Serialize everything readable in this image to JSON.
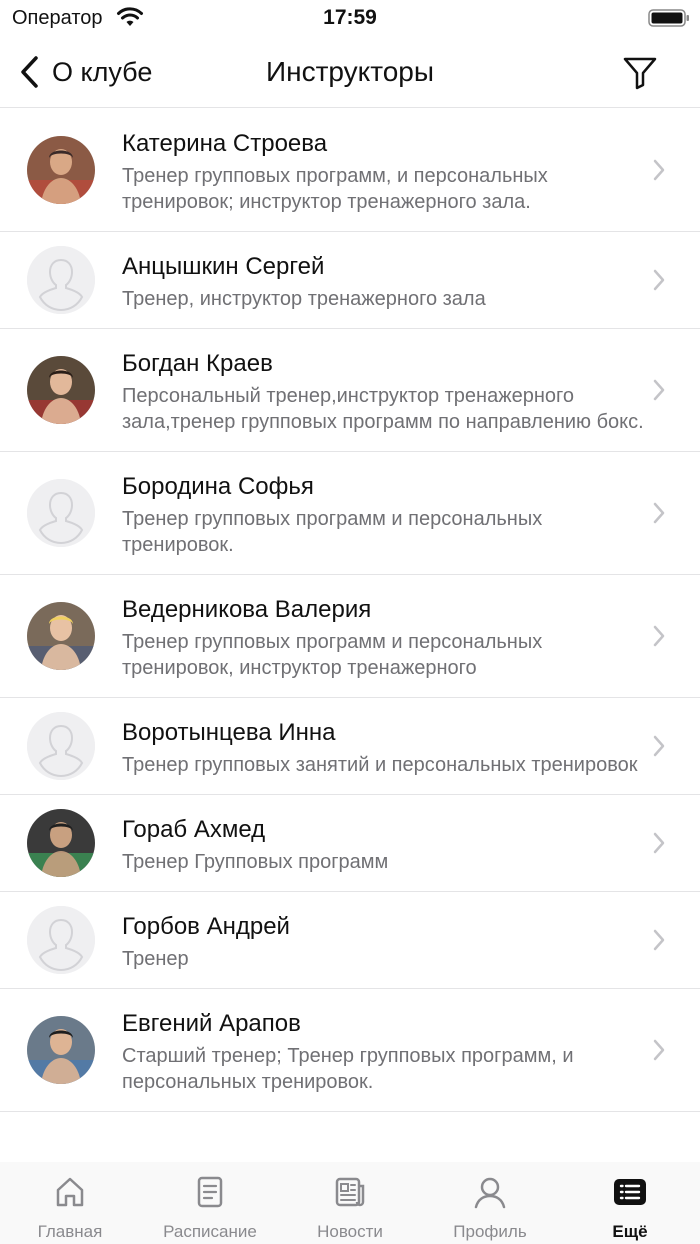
{
  "status_bar": {
    "carrier": "Оператор",
    "time": "17:59"
  },
  "nav": {
    "back_label": "О клубе",
    "title": "Инструкторы"
  },
  "instructors": [
    {
      "name": "Катерина Строева",
      "description": "Тренер групповых программ, и персональных тренировок; инструктор тренажерного зала.",
      "avatar": "photo"
    },
    {
      "name": "Анцышкин Сергей",
      "description": "Тренер, инструктор тренажерного зала",
      "avatar": "placeholder"
    },
    {
      "name": "Богдан Краев",
      "description": "Персональный тренер,инструктор тренажерного зала,тренер групповых программ по направлению бокс.",
      "avatar": "photo"
    },
    {
      "name": "Бородина Софья",
      "description": "Тренер групповых программ и персональных тренировок.",
      "avatar": "placeholder"
    },
    {
      "name": "Ведерникова Валерия",
      "description": "Тренер групповых программ и персональных тренировок, инструктор тренажерного",
      "avatar": "photo"
    },
    {
      "name": "Воротынцева Инна",
      "description": "Тренер групповых занятий и персональных тренировок",
      "avatar": "placeholder"
    },
    {
      "name": "Гораб Ахмед",
      "description": "Тренер Групповых программ",
      "avatar": "photo"
    },
    {
      "name": "Горбов Андрей",
      "description": "Тренер",
      "avatar": "placeholder"
    },
    {
      "name": "Евгений Арапов",
      "description": "Старший тренер; Тренер групповых программ, и персональных тренировок.",
      "avatar": "photo"
    }
  ],
  "tabs": [
    {
      "label": "Главная",
      "icon": "home-icon"
    },
    {
      "label": "Расписание",
      "icon": "schedule-icon"
    },
    {
      "label": "Новости",
      "icon": "news-icon"
    },
    {
      "label": "Профиль",
      "icon": "profile-icon"
    },
    {
      "label": "Ещё",
      "icon": "more-icon",
      "active": true
    }
  ],
  "colors": {
    "accent": "#111111",
    "inactive": "#8a8a8e",
    "secondary_text": "#707074"
  }
}
